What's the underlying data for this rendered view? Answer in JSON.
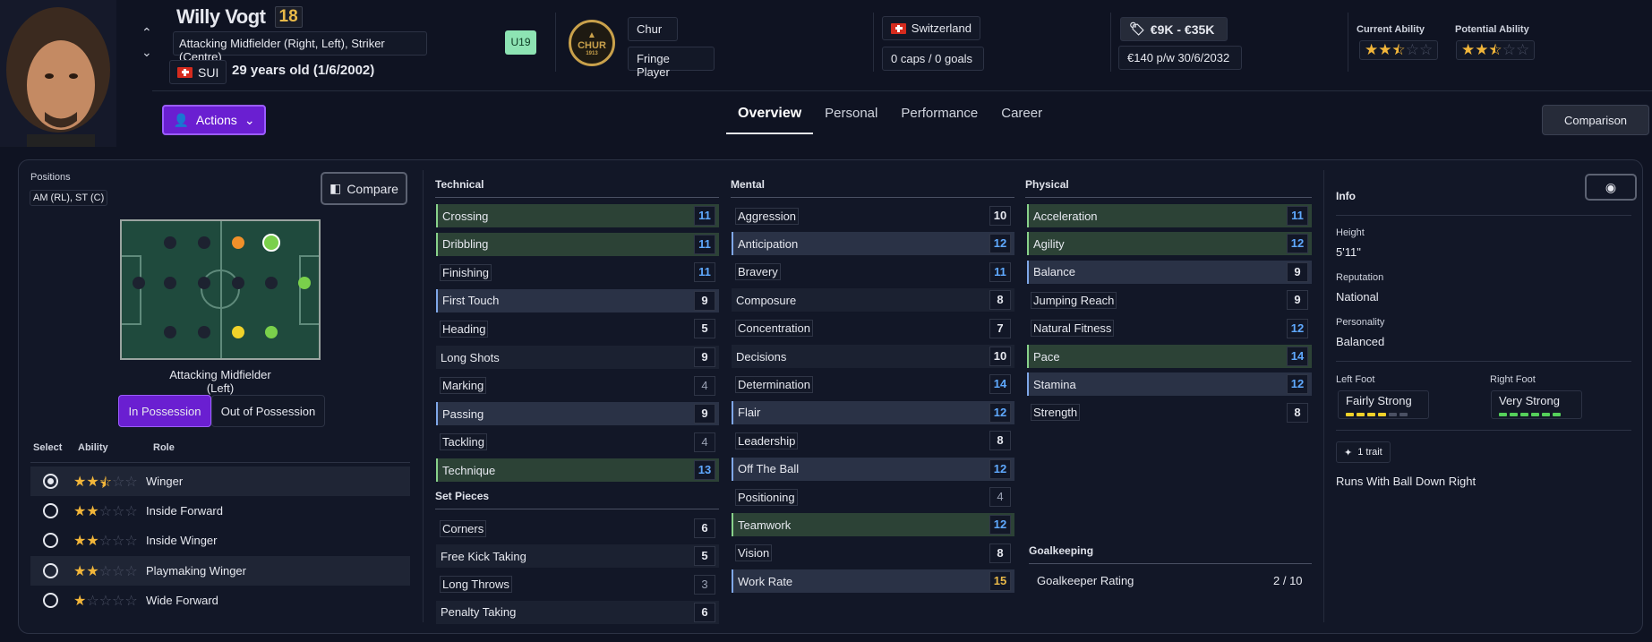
{
  "player": {
    "name": "Willy Vogt",
    "number": "18",
    "positions_full": "Attacking Midfielder (Right, Left), Striker (Centre)",
    "nationality_code": "SUI",
    "age_line": "29 years old (1/6/2002)",
    "squad_badge": "U19"
  },
  "club": {
    "logo_text": "CHUR",
    "logo_year": "1913",
    "name": "Chur",
    "status": "Fringe Player"
  },
  "international": {
    "country": "Switzerland",
    "caps": "0 caps / 0 goals"
  },
  "contract": {
    "value": "€9K - €35K",
    "wage_expiry": "€140 p/w  30/6/2032"
  },
  "ability": {
    "current_label": "Current Ability",
    "potential_label": "Potential Ability",
    "current_stars": 2.5,
    "potential_stars": 2.5
  },
  "actions_label": "Actions",
  "tabs": [
    {
      "label": "Overview",
      "active": true
    },
    {
      "label": "Personal",
      "active": false
    },
    {
      "label": "Performance",
      "active": false
    },
    {
      "label": "Career",
      "active": false
    }
  ],
  "comparison_label": "Comparison",
  "positions": {
    "label": "Positions",
    "value": "AM (RL), ST (C)",
    "compare_label": "Compare",
    "selected_role_title": "Attacking Midfielder (Left)",
    "in_possession": "In Possession",
    "out_possession": "Out of Possession"
  },
  "role_table": {
    "headers": [
      "Select",
      "Ability",
      "Role"
    ],
    "rows": [
      {
        "role": "Winger",
        "stars": 2.5,
        "selected": true
      },
      {
        "role": "Inside Forward",
        "stars": 2,
        "selected": false
      },
      {
        "role": "Inside Winger",
        "stars": 2,
        "selected": false
      },
      {
        "role": "Playmaking Winger",
        "stars": 2,
        "selected": false
      },
      {
        "role": "Wide Forward",
        "stars": 1,
        "selected": false
      }
    ]
  },
  "technical": {
    "title": "Technical",
    "rows": [
      {
        "name": "Crossing",
        "value": "11",
        "style": "green"
      },
      {
        "name": "Dribbling",
        "value": "11",
        "style": "green"
      },
      {
        "name": "Finishing",
        "value": "11",
        "style": "plain"
      },
      {
        "name": "First Touch",
        "value": "9",
        "style": "blue"
      },
      {
        "name": "Heading",
        "value": "5",
        "style": "plain"
      },
      {
        "name": "Long Shots",
        "value": "9",
        "style": "dark"
      },
      {
        "name": "Marking",
        "value": "4",
        "style": "plain"
      },
      {
        "name": "Passing",
        "value": "9",
        "style": "blue"
      },
      {
        "name": "Tackling",
        "value": "4",
        "style": "plain"
      },
      {
        "name": "Technique",
        "value": "13",
        "style": "green"
      }
    ]
  },
  "set_pieces": {
    "title": "Set Pieces",
    "rows": [
      {
        "name": "Corners",
        "value": "6",
        "style": "plain"
      },
      {
        "name": "Free Kick Taking",
        "value": "5",
        "style": "dark"
      },
      {
        "name": "Long Throws",
        "value": "3",
        "style": "plain"
      },
      {
        "name": "Penalty Taking",
        "value": "6",
        "style": "dark"
      }
    ]
  },
  "mental": {
    "title": "Mental",
    "rows": [
      {
        "name": "Aggression",
        "value": "10",
        "style": "plain"
      },
      {
        "name": "Anticipation",
        "value": "12",
        "style": "blue"
      },
      {
        "name": "Bravery",
        "value": "11",
        "style": "plain"
      },
      {
        "name": "Composure",
        "value": "8",
        "style": "dark"
      },
      {
        "name": "Concentration",
        "value": "7",
        "style": "plain"
      },
      {
        "name": "Decisions",
        "value": "10",
        "style": "dark"
      },
      {
        "name": "Determination",
        "value": "14",
        "style": "plain"
      },
      {
        "name": "Flair",
        "value": "12",
        "style": "blue"
      },
      {
        "name": "Leadership",
        "value": "8",
        "style": "plain"
      },
      {
        "name": "Off The Ball",
        "value": "12",
        "style": "blue"
      },
      {
        "name": "Positioning",
        "value": "4",
        "style": "plain"
      },
      {
        "name": "Teamwork",
        "value": "12",
        "style": "green"
      },
      {
        "name": "Vision",
        "value": "8",
        "style": "plain"
      },
      {
        "name": "Work Rate",
        "value": "15",
        "style": "blue"
      }
    ]
  },
  "physical": {
    "title": "Physical",
    "rows": [
      {
        "name": "Acceleration",
        "value": "11",
        "style": "green"
      },
      {
        "name": "Agility",
        "value": "12",
        "style": "green"
      },
      {
        "name": "Balance",
        "value": "9",
        "style": "blue"
      },
      {
        "name": "Jumping Reach",
        "value": "9",
        "style": "plain"
      },
      {
        "name": "Natural Fitness",
        "value": "12",
        "style": "plain"
      },
      {
        "name": "Pace",
        "value": "14",
        "style": "green"
      },
      {
        "name": "Stamina",
        "value": "12",
        "style": "blue"
      },
      {
        "name": "Strength",
        "value": "8",
        "style": "plain"
      }
    ]
  },
  "goalkeeping": {
    "title": "Goalkeeping",
    "rating_label": "Goalkeeper Rating",
    "rating_value": "2 / 10"
  },
  "info": {
    "title": "Info",
    "height_label": "Height",
    "height": "5'11\"",
    "reputation_label": "Reputation",
    "reputation": "National",
    "personality_label": "Personality",
    "personality": "Balanced",
    "left_foot_label": "Left Foot",
    "left_foot": "Fairly Strong",
    "left_foot_level": 4,
    "right_foot_label": "Right Foot",
    "right_foot": "Very Strong",
    "right_foot_level": 6,
    "trait_count": "1 trait",
    "trait": "Runs With Ball Down Right"
  },
  "colors": {
    "accent_purple": "#6a1fd1",
    "star": "#f2b63a",
    "attr_blue": "#5fa9ff",
    "attr_orange": "#e9b949",
    "u19_green": "#8de3b3"
  }
}
